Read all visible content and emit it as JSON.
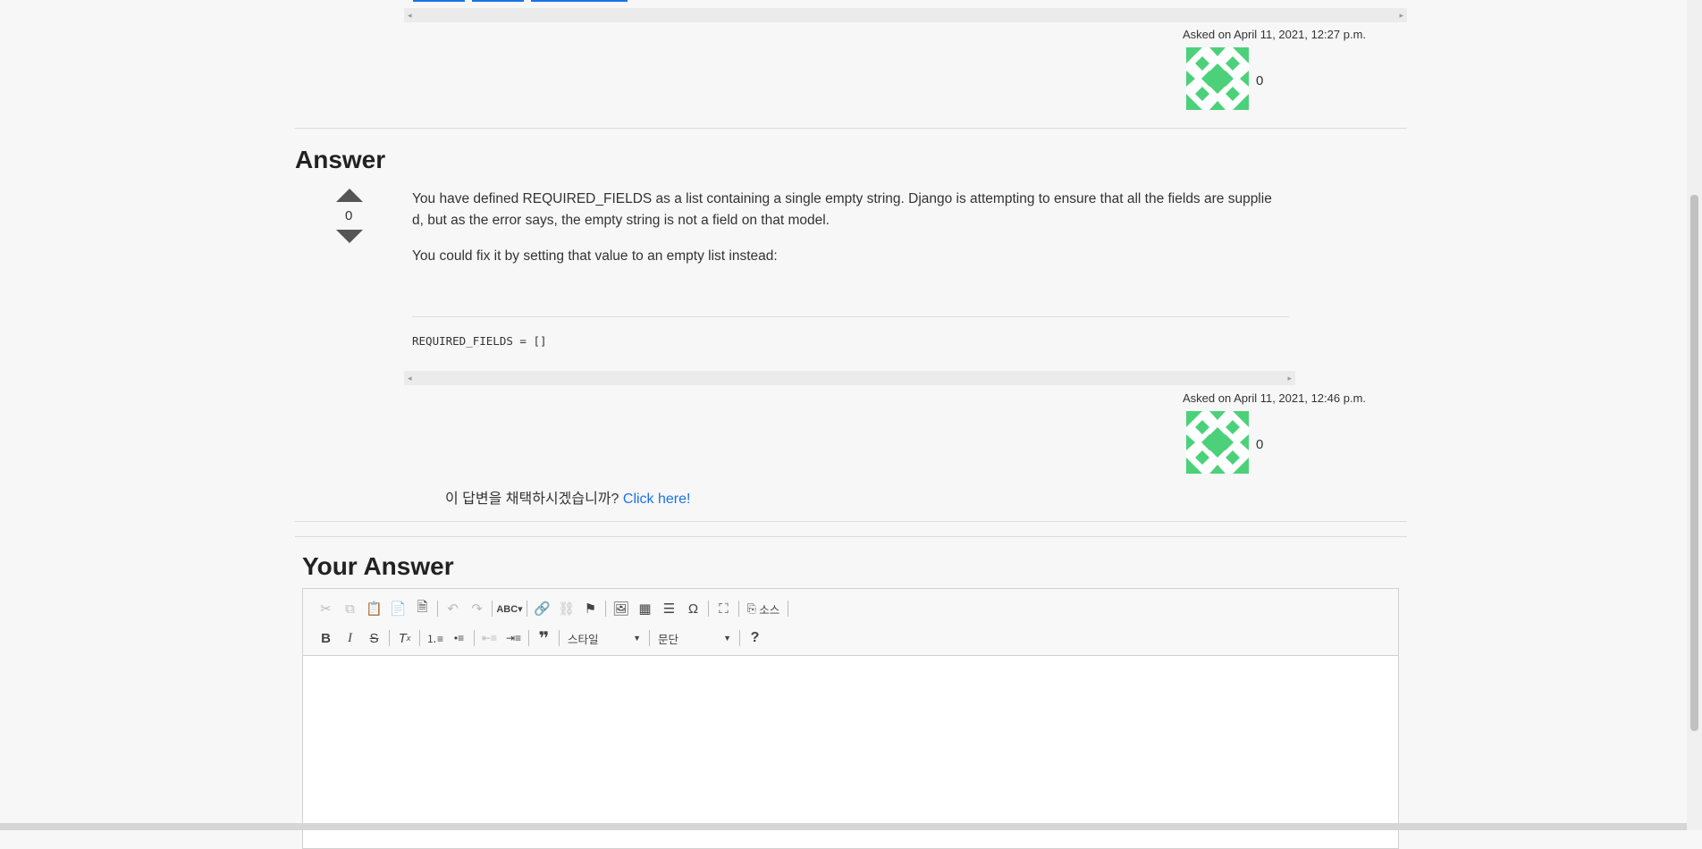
{
  "question": {
    "asked_label": "Asked on April 11, 2021, 12:27 p.m.",
    "score": "0"
  },
  "answer": {
    "section_title": "Answer",
    "vote_count": "0",
    "paragraph1": "You have defined REQUIRED_FIELDS as a list containing a single empty string. Django is attempting to ensure that all the fields are supplie d, but as the error says, the empty string is not a field on that model.",
    "paragraph2": "You could fix it by setting that value to an empty list instead:",
    "code": "REQUIRED_FIELDS = []",
    "asked_label": "Asked on April 11, 2021, 12:46 p.m.",
    "score": "0",
    "accept_prompt": "이 답변을 채택하시겠습니까?",
    "accept_link": "Click here!"
  },
  "your_answer": {
    "section_title": "Your Answer",
    "toolbar": {
      "row1": [
        "cut-icon",
        "copy-icon",
        "paste-icon",
        "paste-text-icon",
        "paste-word-icon",
        "undo-icon",
        "redo-icon",
        "spellcheck-icon",
        "link-icon",
        "unlink-icon",
        "anchor-icon",
        "image-icon",
        "table-icon",
        "horizontal-line-icon",
        "special-char-icon",
        "maximize-icon",
        "source-icon"
      ],
      "source_label": "소스",
      "row2": [
        "bold-icon",
        "italic-icon",
        "strike-icon",
        "remove-format-icon",
        "numbered-list-icon",
        "bulleted-list-icon",
        "outdent-icon",
        "indent-icon",
        "blockquote-icon"
      ],
      "style_label": "스타일",
      "format_label": "문단",
      "help_label": "?"
    }
  }
}
